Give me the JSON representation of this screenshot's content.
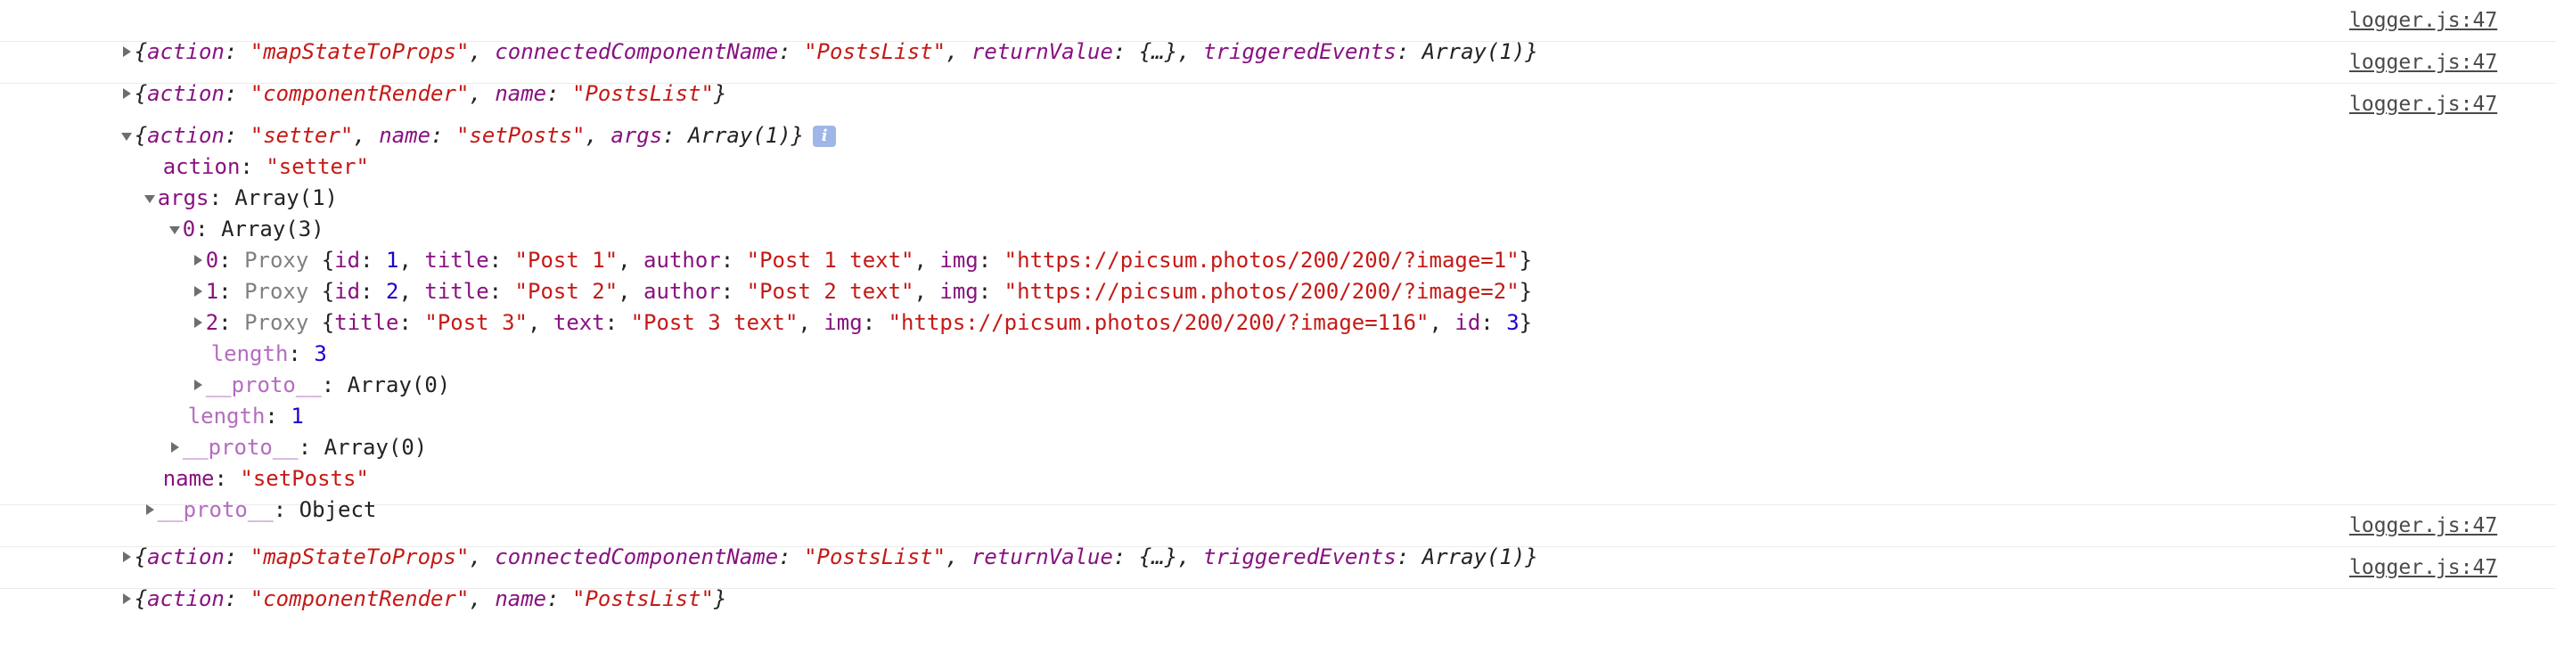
{
  "entries": [
    {
      "summary": {
        "open": "{",
        "k1": "action",
        "v1": "\"mapStateToProps\"",
        "k2": "connectedComponentName",
        "v2": "\"PostsList\"",
        "k3": "returnValue",
        "v3": "{…}",
        "k4": "triggeredEvents",
        "v4": "Array(1)",
        "close": "}"
      },
      "source": "logger.js:47"
    },
    {
      "summary": {
        "open": "{",
        "k1": "action",
        "v1": "\"componentRender\"",
        "k2": "name",
        "v2": "\"PostsList\"",
        "close": "}"
      },
      "source": "logger.js:47"
    },
    {
      "summary": {
        "open": "{",
        "k1": "action",
        "v1": "\"setter\"",
        "k2": "name",
        "v2": "\"setPosts\"",
        "k3": "args",
        "v3": "Array(1)",
        "close": "}",
        "info": "i"
      },
      "source": "logger.js:47",
      "tree": {
        "action_key": "action",
        "action_val": "\"setter\"",
        "args_key": "args",
        "args_val": "Array(1)",
        "inner_key": "0",
        "inner_val": "Array(3)",
        "items": [
          {
            "index": "0",
            "label": "Proxy",
            "p1k": "id",
            "p1v": "1",
            "p2k": "title",
            "p2v": "\"Post 1\"",
            "p3k": "author",
            "p3v": "\"Post 1 text\"",
            "p4k": "img",
            "p4v": "\"https://picsum.photos/200/200/?image=1\""
          },
          {
            "index": "1",
            "label": "Proxy",
            "p1k": "id",
            "p1v": "2",
            "p2k": "title",
            "p2v": "\"Post 2\"",
            "p3k": "author",
            "p3v": "\"Post 2 text\"",
            "p4k": "img",
            "p4v": "\"https://picsum.photos/200/200/?image=2\""
          },
          {
            "index": "2",
            "label": "Proxy",
            "p1k": "title",
            "p1v": "\"Post 3\"",
            "p2k": "text",
            "p2v": "\"Post 3 text\"",
            "p3k": "img",
            "p3v": "\"https://picsum.photos/200/200/?image=116\"",
            "p4k": "id",
            "p4v": "3"
          }
        ],
        "inner_length_key": "length",
        "inner_length_val": "3",
        "inner_proto_key": "__proto__",
        "inner_proto_val": "Array(0)",
        "outer_length_key": "length",
        "outer_length_val": "1",
        "outer_proto_key": "__proto__",
        "outer_proto_val": "Array(0)",
        "name_key": "name",
        "name_val": "\"setPosts\"",
        "obj_proto_key": "__proto__",
        "obj_proto_val": "Object"
      }
    },
    {
      "summary": {
        "open": "{",
        "k1": "action",
        "v1": "\"mapStateToProps\"",
        "k2": "connectedComponentName",
        "v2": "\"PostsList\"",
        "k3": "returnValue",
        "v3": "{…}",
        "k4": "triggeredEvents",
        "v4": "Array(1)",
        "close": "}"
      },
      "source": "logger.js:47"
    },
    {
      "summary": {
        "open": "{",
        "k1": "action",
        "v1": "\"componentRender\"",
        "k2": "name",
        "v2": "\"PostsList\"",
        "close": "}"
      },
      "source": "logger.js:47"
    }
  ]
}
